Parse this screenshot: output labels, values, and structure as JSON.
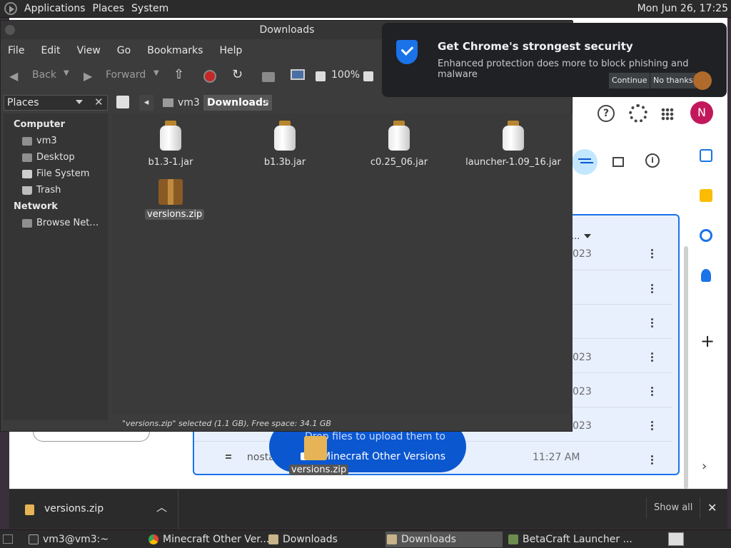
{
  "top_panel": {
    "menus": [
      "Applications",
      "Places",
      "System"
    ],
    "clock": "Mon Jun 26, 17:25"
  },
  "notification": {
    "title": "Get Chrome's strongest security",
    "body": "Enhanced protection does more to block phishing and malware",
    "continue": "Continue",
    "no_thanks": "No thanks"
  },
  "file_manager": {
    "title": "Downloads",
    "menus": [
      "File",
      "Edit",
      "View",
      "Go",
      "Bookmarks",
      "Help"
    ],
    "toolbar": {
      "back": "Back",
      "forward": "Forward",
      "zoom": "100%"
    },
    "pathbar": [
      "vm3",
      "Downloads"
    ],
    "sidebar": {
      "selector": "Places",
      "sections": [
        {
          "heading": "Computer",
          "items": [
            "vm3",
            "Desktop",
            "File System",
            "Trash"
          ]
        },
        {
          "heading": "Network",
          "items": [
            "Browse Net…"
          ]
        }
      ]
    },
    "files": [
      {
        "name": "b1.3-1.jar",
        "type": "jar"
      },
      {
        "name": "b1.3b.jar",
        "type": "jar"
      },
      {
        "name": "c0.25_06.jar",
        "type": "jar"
      },
      {
        "name": "launcher-1.09_16.jar",
        "type": "jar"
      },
      {
        "name": "versions.zip",
        "type": "zip",
        "selected": true
      }
    ],
    "status": "\"versions.zip\" selected (1.1 GB), Free space: 34.1 GB"
  },
  "chrome": {
    "rows": [
      {
        "date": "023"
      },
      {
        "date": ""
      },
      {
        "date": ""
      },
      {
        "date": "023"
      },
      {
        "date": "023"
      },
      {
        "date": "023"
      }
    ],
    "last_row": {
      "owner": "nosta",
      "name": "Minecraft Other Versions",
      "time": "11:27 AM"
    },
    "upload_hint": "Drop files to upload them to",
    "profile_letter": "N",
    "folded_header": "..."
  },
  "drag": {
    "label": "versions.zip"
  },
  "download_bar": {
    "file": "versions.zip",
    "show_all": "Show all"
  },
  "taskbar": [
    {
      "label": "vm3@vm3:~"
    },
    {
      "label": "Minecraft Other Ver..."
    },
    {
      "label": "Downloads"
    },
    {
      "label": "Downloads"
    },
    {
      "label": "BetaCraft Launcher ..."
    }
  ]
}
